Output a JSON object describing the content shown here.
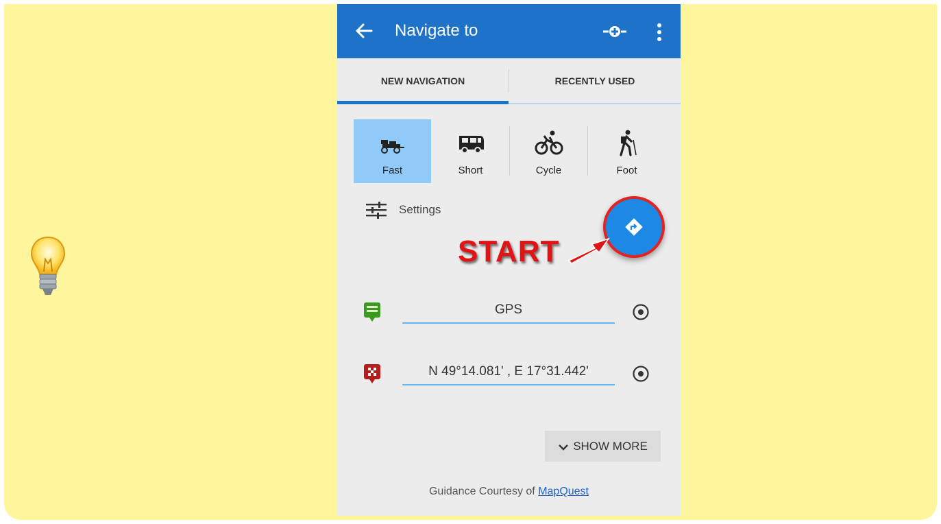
{
  "appbar": {
    "title": "Navigate to"
  },
  "tabs": [
    {
      "label": "NEW NAVIGATION",
      "active": true
    },
    {
      "label": "RECENTLY USED",
      "active": false
    }
  ],
  "modes": [
    {
      "label": "Fast",
      "icon": "race-car-icon",
      "selected": true
    },
    {
      "label": "Short",
      "icon": "van-icon",
      "selected": false
    },
    {
      "label": "Cycle",
      "icon": "bicycle-icon",
      "selected": false
    },
    {
      "label": "Foot",
      "icon": "hiker-icon",
      "selected": false
    }
  ],
  "settings": {
    "label": "Settings"
  },
  "annotation": {
    "start_label": "START"
  },
  "route": {
    "from": "GPS",
    "to": "N 49°14.081' , E 17°31.442'"
  },
  "show_more": {
    "label": "SHOW MORE"
  },
  "footer": {
    "prefix": "Guidance Courtesy of",
    "link": "MapQuest"
  },
  "colors": {
    "note_background": "#fff59d",
    "appbar": "#1e73c9",
    "selected_mode": "#90caf9",
    "start_annotation": "#e01414",
    "fab": "#1e88e5"
  }
}
